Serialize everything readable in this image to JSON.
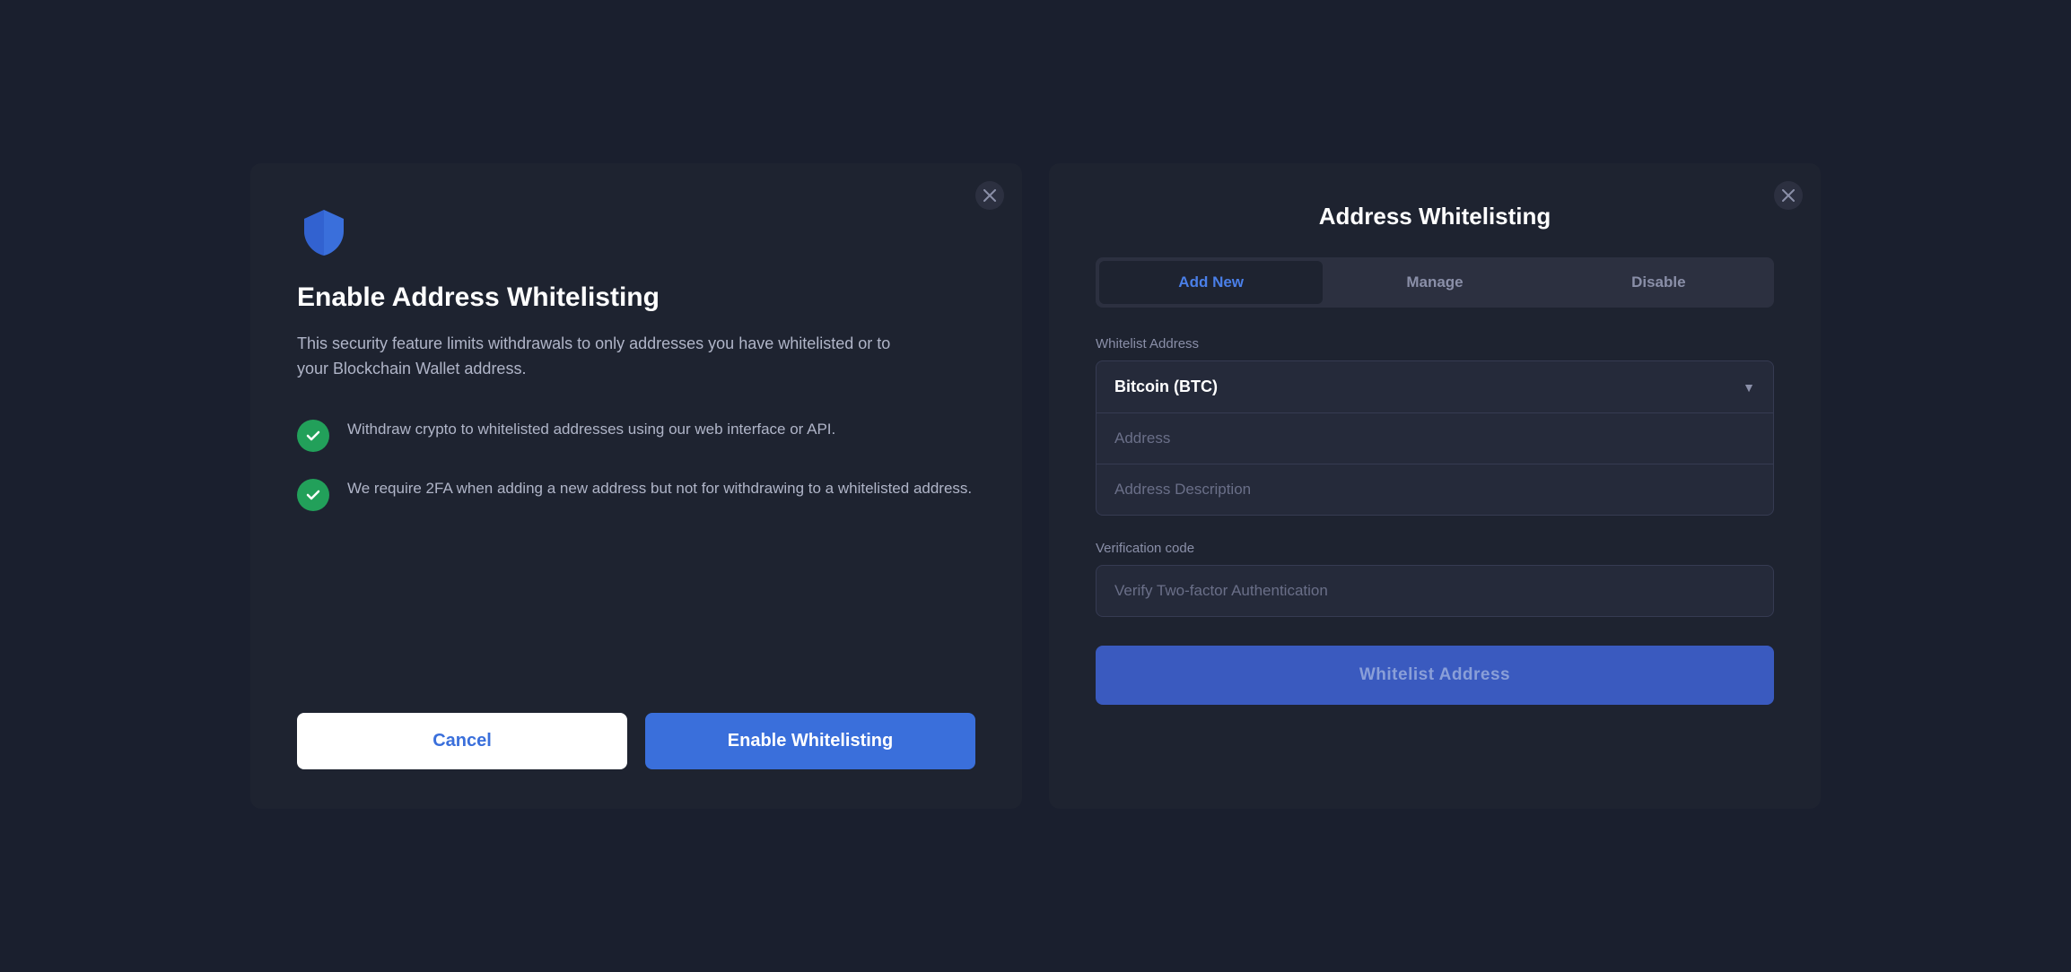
{
  "left_modal": {
    "title": "Enable Address Whitelisting",
    "description": "This security feature limits withdrawals to only addresses you have whitelisted or to your Blockchain Wallet address.",
    "features": [
      {
        "text": "Withdraw crypto to whitelisted addresses using our web interface or API."
      },
      {
        "text": "We require 2FA when adding a new address but not for withdrawing to a whitelisted address."
      }
    ],
    "cancel_label": "Cancel",
    "enable_label": "Enable Whitelisting"
  },
  "right_modal": {
    "title": "Address Whitelisting",
    "tabs": [
      {
        "label": "Add New",
        "active": true
      },
      {
        "label": "Manage",
        "active": false
      },
      {
        "label": "Disable",
        "active": false
      }
    ],
    "whitelist_address_label": "Whitelist Address",
    "crypto_value": "Bitcoin (BTC)",
    "address_placeholder": "Address",
    "address_desc_placeholder": "Address Description",
    "verification_label": "Verification code",
    "verify_placeholder": "Verify Two-factor Authentication",
    "submit_label": "Whitelist Address"
  }
}
